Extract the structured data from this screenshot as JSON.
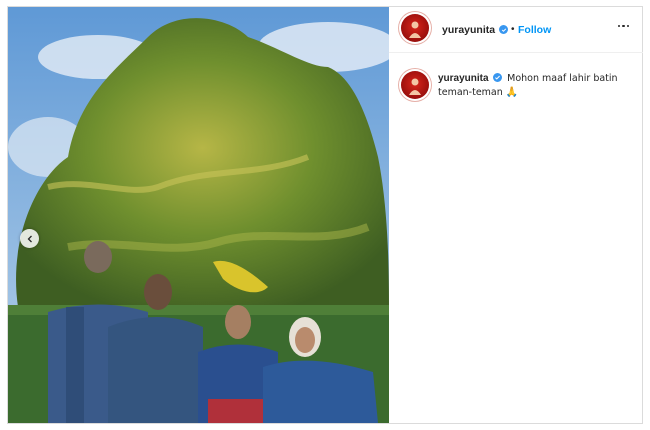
{
  "post": {
    "image_alt": "Four people standing in front of a large tree",
    "carousel_prev_icon": "chevron-left-icon"
  },
  "header": {
    "username": "yurayunita",
    "separator": "•",
    "follow_label": "Follow",
    "more_icon": "more-horizontal-icon",
    "verified_icon": "verified-badge-icon"
  },
  "caption": {
    "username": "yurayunita",
    "text": "Mohon maaf lahir batin teman-teman",
    "emoji": "🙏"
  },
  "colors": {
    "follow": "#0095f6",
    "verified": "#3897f0",
    "avatar": "#d8261c"
  }
}
